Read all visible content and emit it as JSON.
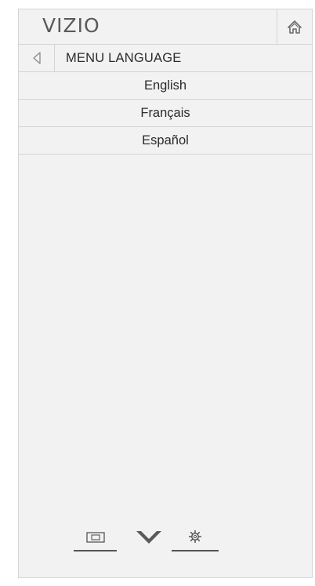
{
  "header": {
    "logo_text": "VIZIO",
    "home_icon": "home-icon"
  },
  "menu": {
    "back_icon": "back-arrow-icon",
    "title": "MENU LANGUAGE",
    "options": [
      {
        "label": "English"
      },
      {
        "label": "Français"
      },
      {
        "label": "Español"
      }
    ]
  },
  "bottom_bar": {
    "items": [
      {
        "icon": "input-icon"
      },
      {
        "icon": "vizio-v-icon"
      },
      {
        "icon": "gear-icon"
      }
    ]
  },
  "colors": {
    "panel_bg": "#f2f2f2",
    "border": "#d4d4d4",
    "text": "#2b2b2b",
    "logo": "#5a5a5a",
    "icon": "#6b6b6b"
  }
}
